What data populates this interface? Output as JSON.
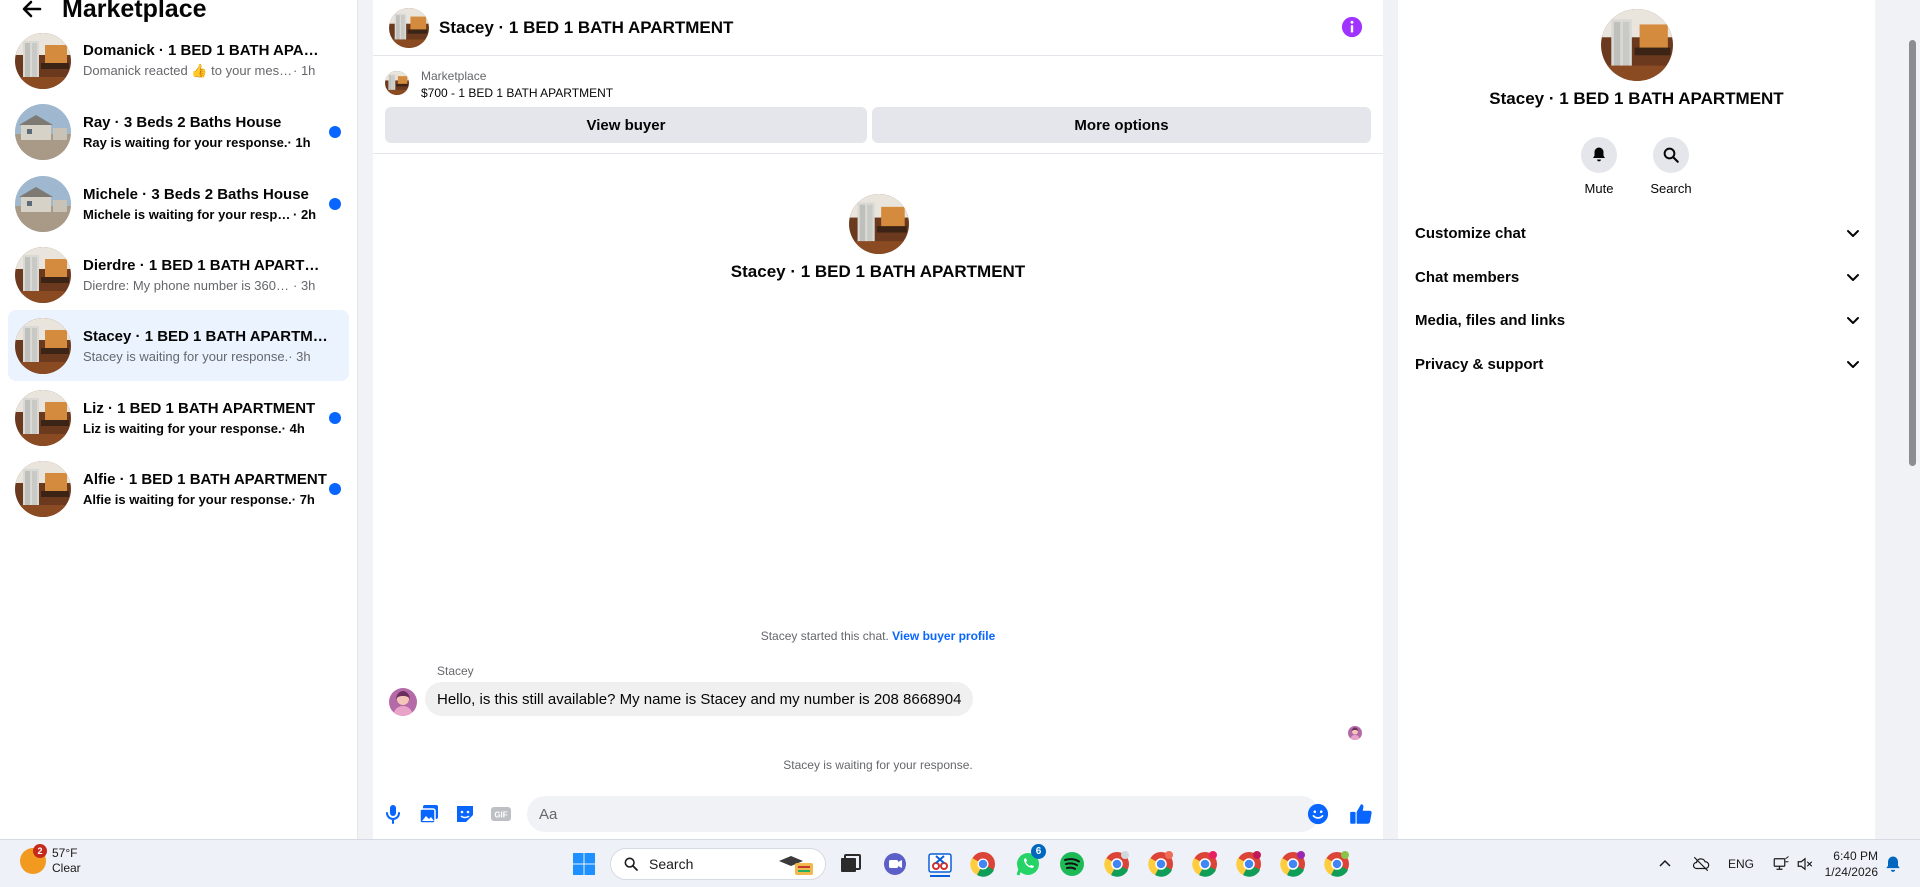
{
  "sidebar": {
    "title": "Marketplace",
    "conversations": [
      {
        "name": "Domanick · 1 BED 1 BATH APARTM...",
        "preview": "Domanick reacted 👍 to your message",
        "time": " · 1h",
        "unread": false,
        "thumb": "apartment"
      },
      {
        "name": "Ray · 3 Beds 2 Baths House",
        "preview": "Ray is waiting for your response.",
        "time": " · 1h",
        "unread": true,
        "thumb": "house"
      },
      {
        "name": "Michele · 3 Beds 2 Baths House",
        "preview": "Michele is waiting for your respon...",
        "time": " · 2h",
        "unread": true,
        "thumb": "house"
      },
      {
        "name": "Dierdre · 1 BED 1 BATH APARTMENT",
        "preview": "Dierdre: My phone number is 360-76...",
        "time": " · 3h",
        "unread": false,
        "thumb": "apartment"
      },
      {
        "name": "Stacey · 1 BED 1 BATH APARTMENT",
        "preview": "Stacey is waiting for your response.",
        "time": " · 3h",
        "unread": false,
        "active": true,
        "thumb": "apartment"
      },
      {
        "name": "Liz · 1 BED 1 BATH APARTMENT",
        "preview": "Liz is waiting for your response.",
        "time": " · 4h",
        "unread": true,
        "thumb": "apartment"
      },
      {
        "name": "Alfie · 1 BED 1 BATH APARTMENT",
        "preview": "Alfie is waiting for your response.",
        "time": " · 7h",
        "unread": true,
        "thumb": "apartment"
      }
    ]
  },
  "chat": {
    "title": "Stacey · 1 BED 1 BATH APARTMENT",
    "listing_label": "Marketplace",
    "listing_title": "$700 - 1 BED 1 BATH APARTMENT",
    "view_buyer": "View buyer",
    "more_options": "More options",
    "intro_title": "Stacey · 1 BED 1 BATH APARTMENT",
    "started_text": "Stacey started this chat.",
    "started_link": "View buyer profile",
    "sender_name": "Stacey",
    "message": "Hello, is this still available? My name is Stacey and my number is 208 8668904",
    "waiting_text": "Stacey is waiting for your response.",
    "composer_placeholder": "Aa"
  },
  "details": {
    "title": "Stacey · 1 BED 1 BATH APARTMENT",
    "mute_label": "Mute",
    "search_label": "Search",
    "sections": [
      "Customize chat",
      "Chat members",
      "Media, files and links",
      "Privacy & support"
    ]
  },
  "taskbar": {
    "weather_badge": "2",
    "temperature": "57°F",
    "condition": "Clear",
    "search_label": "Search",
    "whatsapp_badge": "6",
    "language": "ENG",
    "time": "6:40 PM",
    "date": "1/24/2026"
  },
  "colors": {
    "accent": "#0866ff",
    "info_purple": "#a033ff",
    "active_row": "#ebf3ff"
  }
}
